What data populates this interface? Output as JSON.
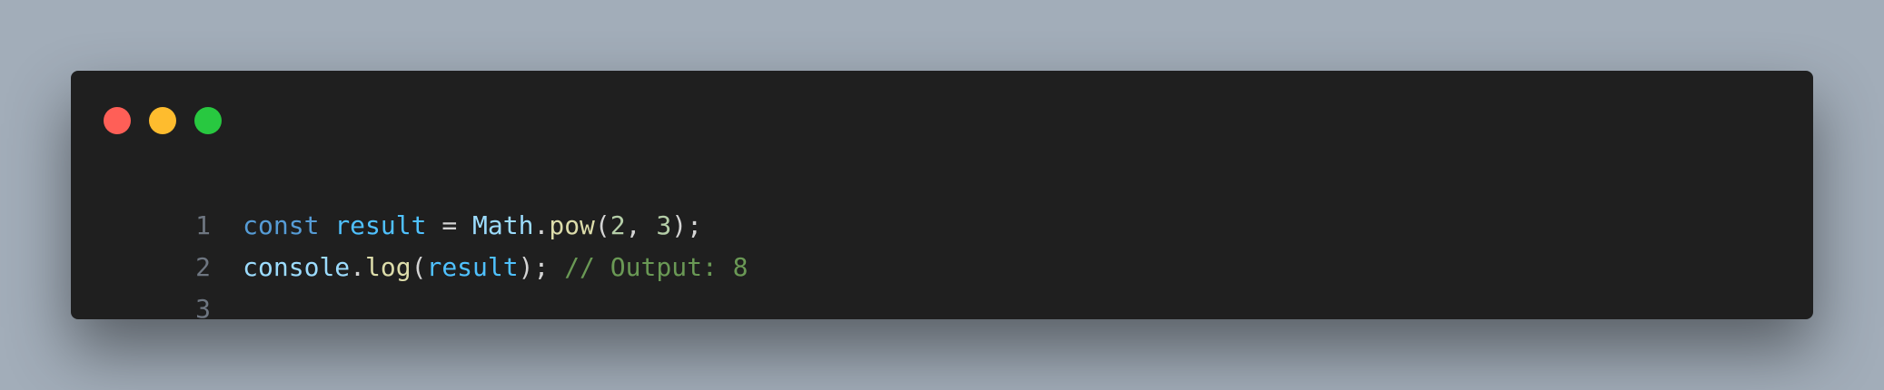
{
  "window": {
    "controls": {
      "close_color": "#ff5f57",
      "minimize_color": "#febc2e",
      "maximize_color": "#28c840"
    }
  },
  "code": {
    "lines": [
      {
        "number": "1",
        "tokens": [
          {
            "text": "const",
            "kind": "keyword"
          },
          {
            "text": " ",
            "kind": "plain"
          },
          {
            "text": "result",
            "kind": "variable"
          },
          {
            "text": " = ",
            "kind": "plain"
          },
          {
            "text": "Math",
            "kind": "class"
          },
          {
            "text": ".",
            "kind": "plain"
          },
          {
            "text": "pow",
            "kind": "method"
          },
          {
            "text": "(",
            "kind": "plain"
          },
          {
            "text": "2",
            "kind": "number"
          },
          {
            "text": ", ",
            "kind": "plain"
          },
          {
            "text": "3",
            "kind": "number"
          },
          {
            "text": ");",
            "kind": "plain"
          }
        ]
      },
      {
        "number": "2",
        "tokens": [
          {
            "text": "console",
            "kind": "class"
          },
          {
            "text": ".",
            "kind": "plain"
          },
          {
            "text": "log",
            "kind": "method"
          },
          {
            "text": "(",
            "kind": "plain"
          },
          {
            "text": "result",
            "kind": "variable"
          },
          {
            "text": "); ",
            "kind": "plain"
          },
          {
            "text": "// Output: 8",
            "kind": "comment"
          }
        ]
      },
      {
        "number": "3",
        "tokens": []
      }
    ]
  },
  "colors": {
    "background": "#a2adb9",
    "window": "#1f1f1f",
    "line_number": "#6e7681",
    "keyword": "#569cd6",
    "variable": "#4fc1ff",
    "plain": "#d4d4d4",
    "class": "#9cdcfe",
    "method": "#dcdcaa",
    "number": "#b5cea8",
    "comment": "#6a9955"
  }
}
